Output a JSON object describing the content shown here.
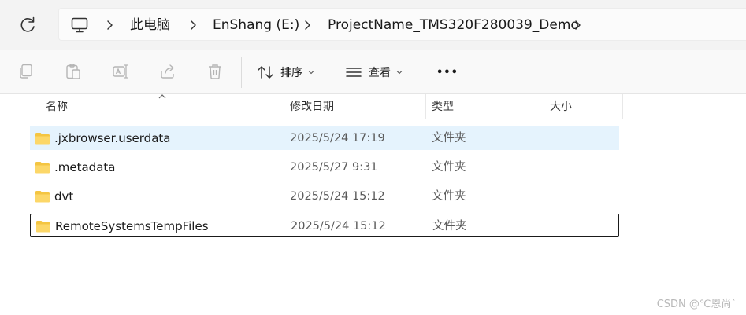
{
  "address": {
    "root_label": "此电脑",
    "drive_label": "EnShang (E:)",
    "folder_label": "ProjectName_TMS320F280039_Demo"
  },
  "toolbar": {
    "sort_label": "排序",
    "view_label": "查看",
    "more_label": "•••"
  },
  "columns": {
    "name": "名称",
    "date": "修改日期",
    "type": "类型",
    "size": "大小"
  },
  "files": [
    {
      "name": ".jxbrowser.userdata",
      "date": "2025/5/24 17:19",
      "type": "文件夹",
      "selected": true
    },
    {
      "name": ".metadata",
      "date": "2025/5/27 9:31",
      "type": "文件夹"
    },
    {
      "name": "dvt",
      "date": "2025/5/24 15:12",
      "type": "文件夹"
    },
    {
      "name": "RemoteSystemsTempFiles",
      "date": "2025/5/24 15:12",
      "type": "文件夹",
      "focused": true
    }
  ],
  "watermark": "CSDN @℃恩尚`",
  "colors": {
    "selection": "#e5f3fd",
    "folder": "#f4c542"
  }
}
